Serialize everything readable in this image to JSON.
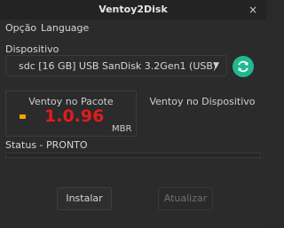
{
  "window": {
    "title": "Ventoy2Disk",
    "close_symbol": "×"
  },
  "menu": {
    "items": [
      "Opção",
      "Language"
    ]
  },
  "device": {
    "section_label": "Dispositivo",
    "selected": "sdc  [16 GB]   USB   SanDisk 3.2Gen1 (USB)",
    "arrow": "▼"
  },
  "panels": {
    "package": {
      "title": "Ventoy no Pacote",
      "version": "1.0.96",
      "partition_style": "MBR"
    },
    "device": {
      "title": "Ventoy no Dispositivo",
      "version": ""
    }
  },
  "status": {
    "text": "Status - PRONTO",
    "progress": 0
  },
  "buttons": {
    "install": "Instalar",
    "update": "Atualizar"
  },
  "colors": {
    "accent": "#1fb990",
    "version": "#e31b1b",
    "secure_icon": "#f2a300"
  },
  "icons": {
    "refresh": "refresh-icon",
    "secure": "secure-boot-icon"
  }
}
